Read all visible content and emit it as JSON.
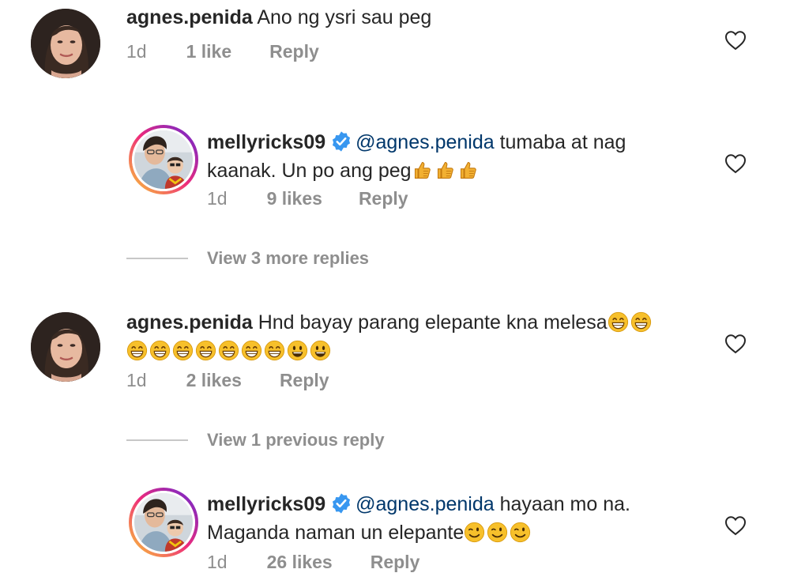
{
  "comments": [
    {
      "username": "agnes.penida",
      "text": "Ano ng ysri sau peg",
      "time": "1d",
      "likes": "1 like",
      "reply": "Reply"
    },
    {
      "username": "mellyricks09",
      "mention": "@agnes.penida",
      "text_line1": " tumaba at nag",
      "text_line2": "kaanak. Un po ang peg",
      "time": "1d",
      "likes": "9 likes",
      "reply": "Reply"
    },
    {
      "username": "agnes.penida",
      "text": "Hnd bayay parang elepante kna melesa",
      "time": "1d",
      "likes": "2 likes",
      "reply": "Reply"
    },
    {
      "username": "mellyricks09",
      "mention": "@agnes.penida",
      "text_line1": " hayaan mo na.",
      "text_line2": "Maganda naman un elepante",
      "time": "1d",
      "likes": "26 likes",
      "reply": "Reply"
    }
  ],
  "view_more_1": "View 3 more replies",
  "view_prev_1": "View 1 previous reply",
  "icons": {
    "verified_color": "#3897f0",
    "heart": "heart-outline-icon",
    "emoji_thumbs": "thumbs-up-emoji",
    "emoji_grin": "grinning-emoji",
    "emoji_smile": "smiley-emoji",
    "emoji_wink": "winking-emoji"
  }
}
